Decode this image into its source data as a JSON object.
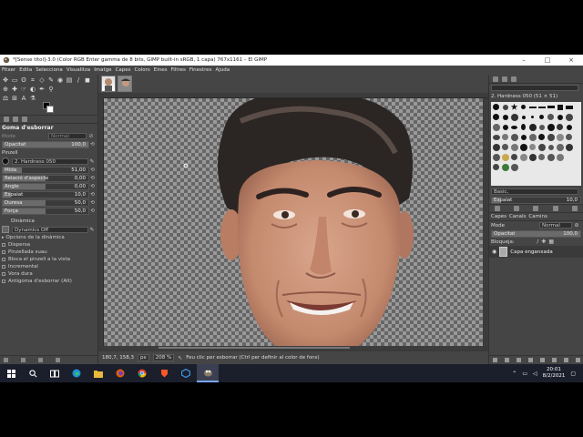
{
  "window": {
    "title": "*[Sense títol]-3.0 (Color RGB Enter gamma de 8 bits, GIMP built-in sRGB, 1 capa) 767x1161 – El GIMP",
    "minimize": "–",
    "maximize": "□",
    "close": "×"
  },
  "menubar": {
    "items": [
      "Fitxer",
      "Edita",
      "Selecciona",
      "Visualitza",
      "Imatge",
      "Capes",
      "Colors",
      "Eines",
      "Filtres",
      "Finestres",
      "Ajuda"
    ]
  },
  "tool_options": {
    "title": "Goma d'esborrar",
    "mode_label": "Mode",
    "mode_value": "Normal",
    "opacity_label": "Opacitat",
    "opacity_value": "100,0",
    "opacity_fraction": 1.0,
    "brush_label": "Pinzell",
    "brush_value": "2. Hardness 050",
    "sliders": [
      {
        "label": "Mida",
        "value": "51,00",
        "fraction": 0.22
      },
      {
        "label": "Relació d'aspecte",
        "value": "0,00",
        "fraction": 0.5
      },
      {
        "label": "Angle",
        "value": "0,00",
        "fraction": 0.5
      },
      {
        "label": "Espaiat",
        "value": "10,0",
        "fraction": 0.1
      },
      {
        "label": "Duresa",
        "value": "50,0",
        "fraction": 0.5
      },
      {
        "label": "Força",
        "value": "50,0",
        "fraction": 0.5
      }
    ],
    "dynamics_label": "Dinàmica",
    "dynamics_value": "Dynamics Off",
    "dynamics_options": "Opcions de la dinàmica",
    "checkboxes": [
      "Dispersa",
      "Pinzellada suau",
      "Bloca el pinzell a la vista",
      "Incremental",
      "Vora dura",
      "Antigoma d'esborrar (Alt)"
    ]
  },
  "status": {
    "coords": "180,7, 158,3",
    "unit": "px",
    "zoom": "208 %",
    "message": "Feu clic per esborrar (Ctrl per definir al color de fons)"
  },
  "brushes_panel": {
    "header": "2. Hardness 050 (51 × 51)",
    "tag": "Basic,",
    "spacing_label": "Espaiat",
    "spacing_value": "10,0"
  },
  "layers_panel": {
    "tabs": [
      "Capes",
      "Canals",
      "Camins"
    ],
    "mode_label": "Mode",
    "mode_value": "Normal",
    "opacity_label": "Opacitat",
    "opacity_value": "100,0",
    "lock_label": "Bloqueja:",
    "layer_name": "Capa enganxada"
  },
  "taskbar": {
    "time": "20:01",
    "date": "8/2/2021"
  }
}
